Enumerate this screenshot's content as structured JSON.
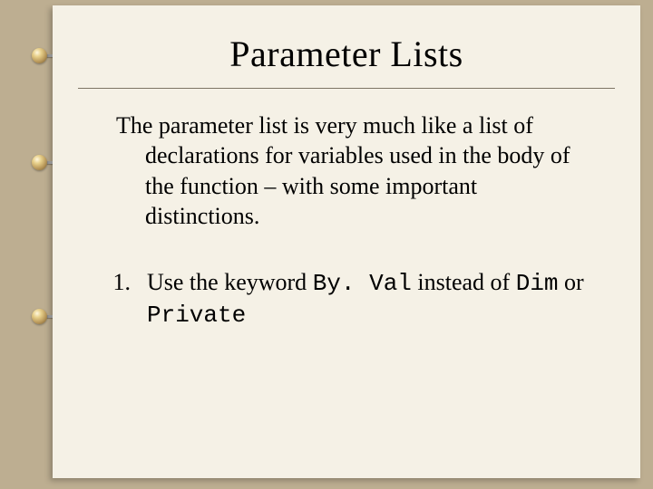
{
  "title": "Parameter Lists",
  "paragraph": "The parameter list is very much like a list of declarations for variables used in the body of the function – with some important distinctions.",
  "list": {
    "number": "1.",
    "pre": "Use the keyword ",
    "kw1": "By. Val",
    "mid": " instead of ",
    "kw2": "Dim",
    "post1": " or ",
    "kw3": "Private"
  }
}
